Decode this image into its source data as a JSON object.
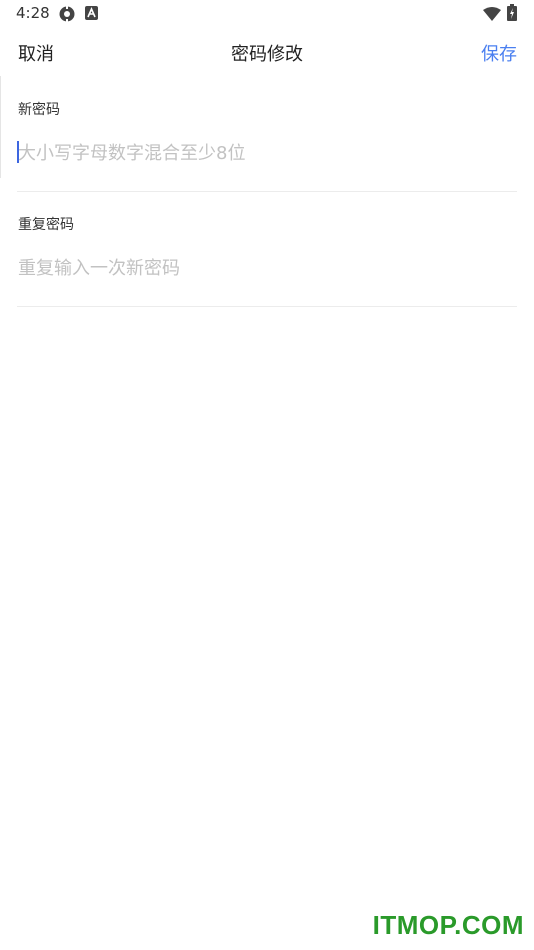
{
  "status_bar": {
    "time": "4:28",
    "icons": [
      "gear-icon",
      "a-notification-icon",
      "wifi-icon",
      "battery-icon"
    ]
  },
  "header": {
    "cancel_label": "取消",
    "title": "密码修改",
    "save_label": "保存",
    "save_color": "#4a7ff0"
  },
  "form": {
    "new_password": {
      "label": "新密码",
      "value": "",
      "placeholder": "大小写字母数字混合至少8位"
    },
    "repeat_password": {
      "label": "重复密码",
      "value": "",
      "placeholder": "重复输入一次新密码"
    }
  },
  "watermark": "ITMOP.COM"
}
